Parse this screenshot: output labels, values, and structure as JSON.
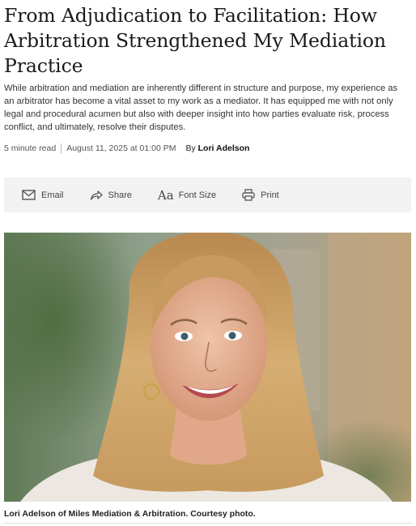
{
  "article": {
    "headline": "From Adjudication to Facilitation: How Arbitration Strengthened My Mediation Practice",
    "dek": "While arbitration and mediation are inherently different in structure and purpose, my experience as an arbitrator has become a vital asset to my work as a mediator. It has equipped me with not only legal and procedural acumen but also with deeper insight into how parties evaluate risk, process conflict, and ultimately, resolve their disputes.",
    "read_time": "5 minute read",
    "date": "August 11, 2025 at 01:00 PM",
    "by": "By",
    "author": "Lori Adelson"
  },
  "share_bar": {
    "email": {
      "label": "Email",
      "icon": "envelope-icon"
    },
    "share": {
      "label": "Share",
      "icon": "share-arrow-icon"
    },
    "font_size": {
      "label": "Font Size",
      "glyph": "Aa",
      "icon": "font-size-icon"
    },
    "print": {
      "label": "Print",
      "icon": "printer-icon"
    }
  },
  "photo": {
    "caption": "Lori Adelson of Miles Mediation & Arbitration. Courtesy photo."
  },
  "colors": {
    "share_bar_bg": "#f2f2f2",
    "headline": "#1a1a1a",
    "hair": "#c79a5e",
    "skin": "#e8b59a"
  }
}
